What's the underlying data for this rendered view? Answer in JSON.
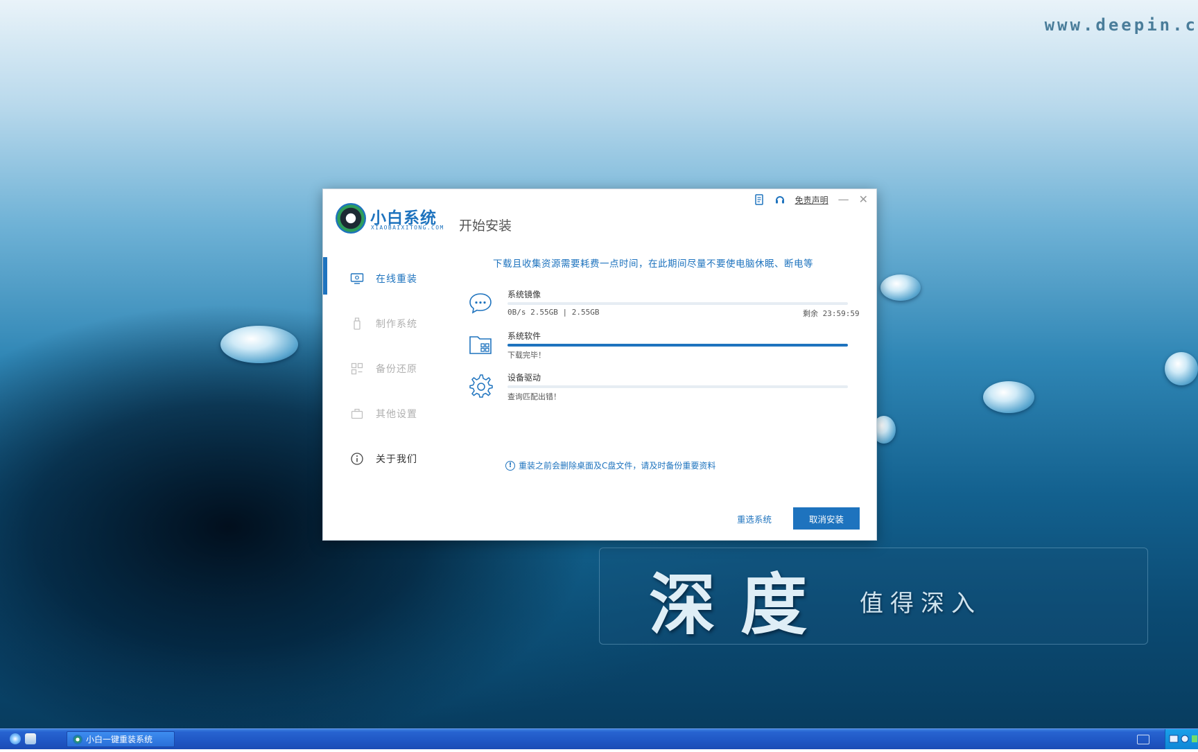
{
  "desktop": {
    "watermark_url": "www.deepin.c",
    "brand_title": "深度",
    "brand_subtitle": "值得深入"
  },
  "window": {
    "app_name": "小白系统",
    "app_subtitle": "XIAOBAIXITONG.COM",
    "page_title": "开始安装",
    "top_controls": {
      "doc_icon": "document-icon",
      "support_icon": "headset-icon",
      "disclaimer": "免责声明",
      "minimize": "—",
      "close": "✕"
    }
  },
  "sidebar": {
    "items": [
      {
        "label": "在线重装",
        "icon": "monitor-icon",
        "active": true
      },
      {
        "label": "制作系统",
        "icon": "usb-icon",
        "active": false
      },
      {
        "label": "备份还原",
        "icon": "grid-icon",
        "active": false
      },
      {
        "label": "其他设置",
        "icon": "briefcase-icon",
        "active": false
      },
      {
        "label": "关于我们",
        "icon": "info-icon",
        "active": false
      }
    ]
  },
  "main": {
    "notice": "下载且收集资源需要耗费一点时间，在此期间尽量不要使电脑休眠、断电等",
    "tasks": [
      {
        "name": "系统镜像",
        "status": "0B/s 2.55GB | 2.55GB",
        "remaining": "剩余 23:59:59",
        "progress": 0,
        "icon": "chat-bubble-icon"
      },
      {
        "name": "系统软件",
        "status": "下载完毕！",
        "remaining": "",
        "progress": 100,
        "icon": "folder-apps-icon"
      },
      {
        "name": "设备驱动",
        "status": "查询匹配出错！",
        "remaining": "",
        "progress": 0,
        "icon": "gear-icon"
      }
    ],
    "warning": "重装之前会删除桌面及C盘文件，请及时备份重要资料",
    "reselect_label": "重选系统",
    "cancel_label": "取消安装"
  },
  "taskbar": {
    "task_label": "小白一键重装系统"
  },
  "colors": {
    "accent": "#1e73be",
    "taskbar": "#1f56c4"
  }
}
